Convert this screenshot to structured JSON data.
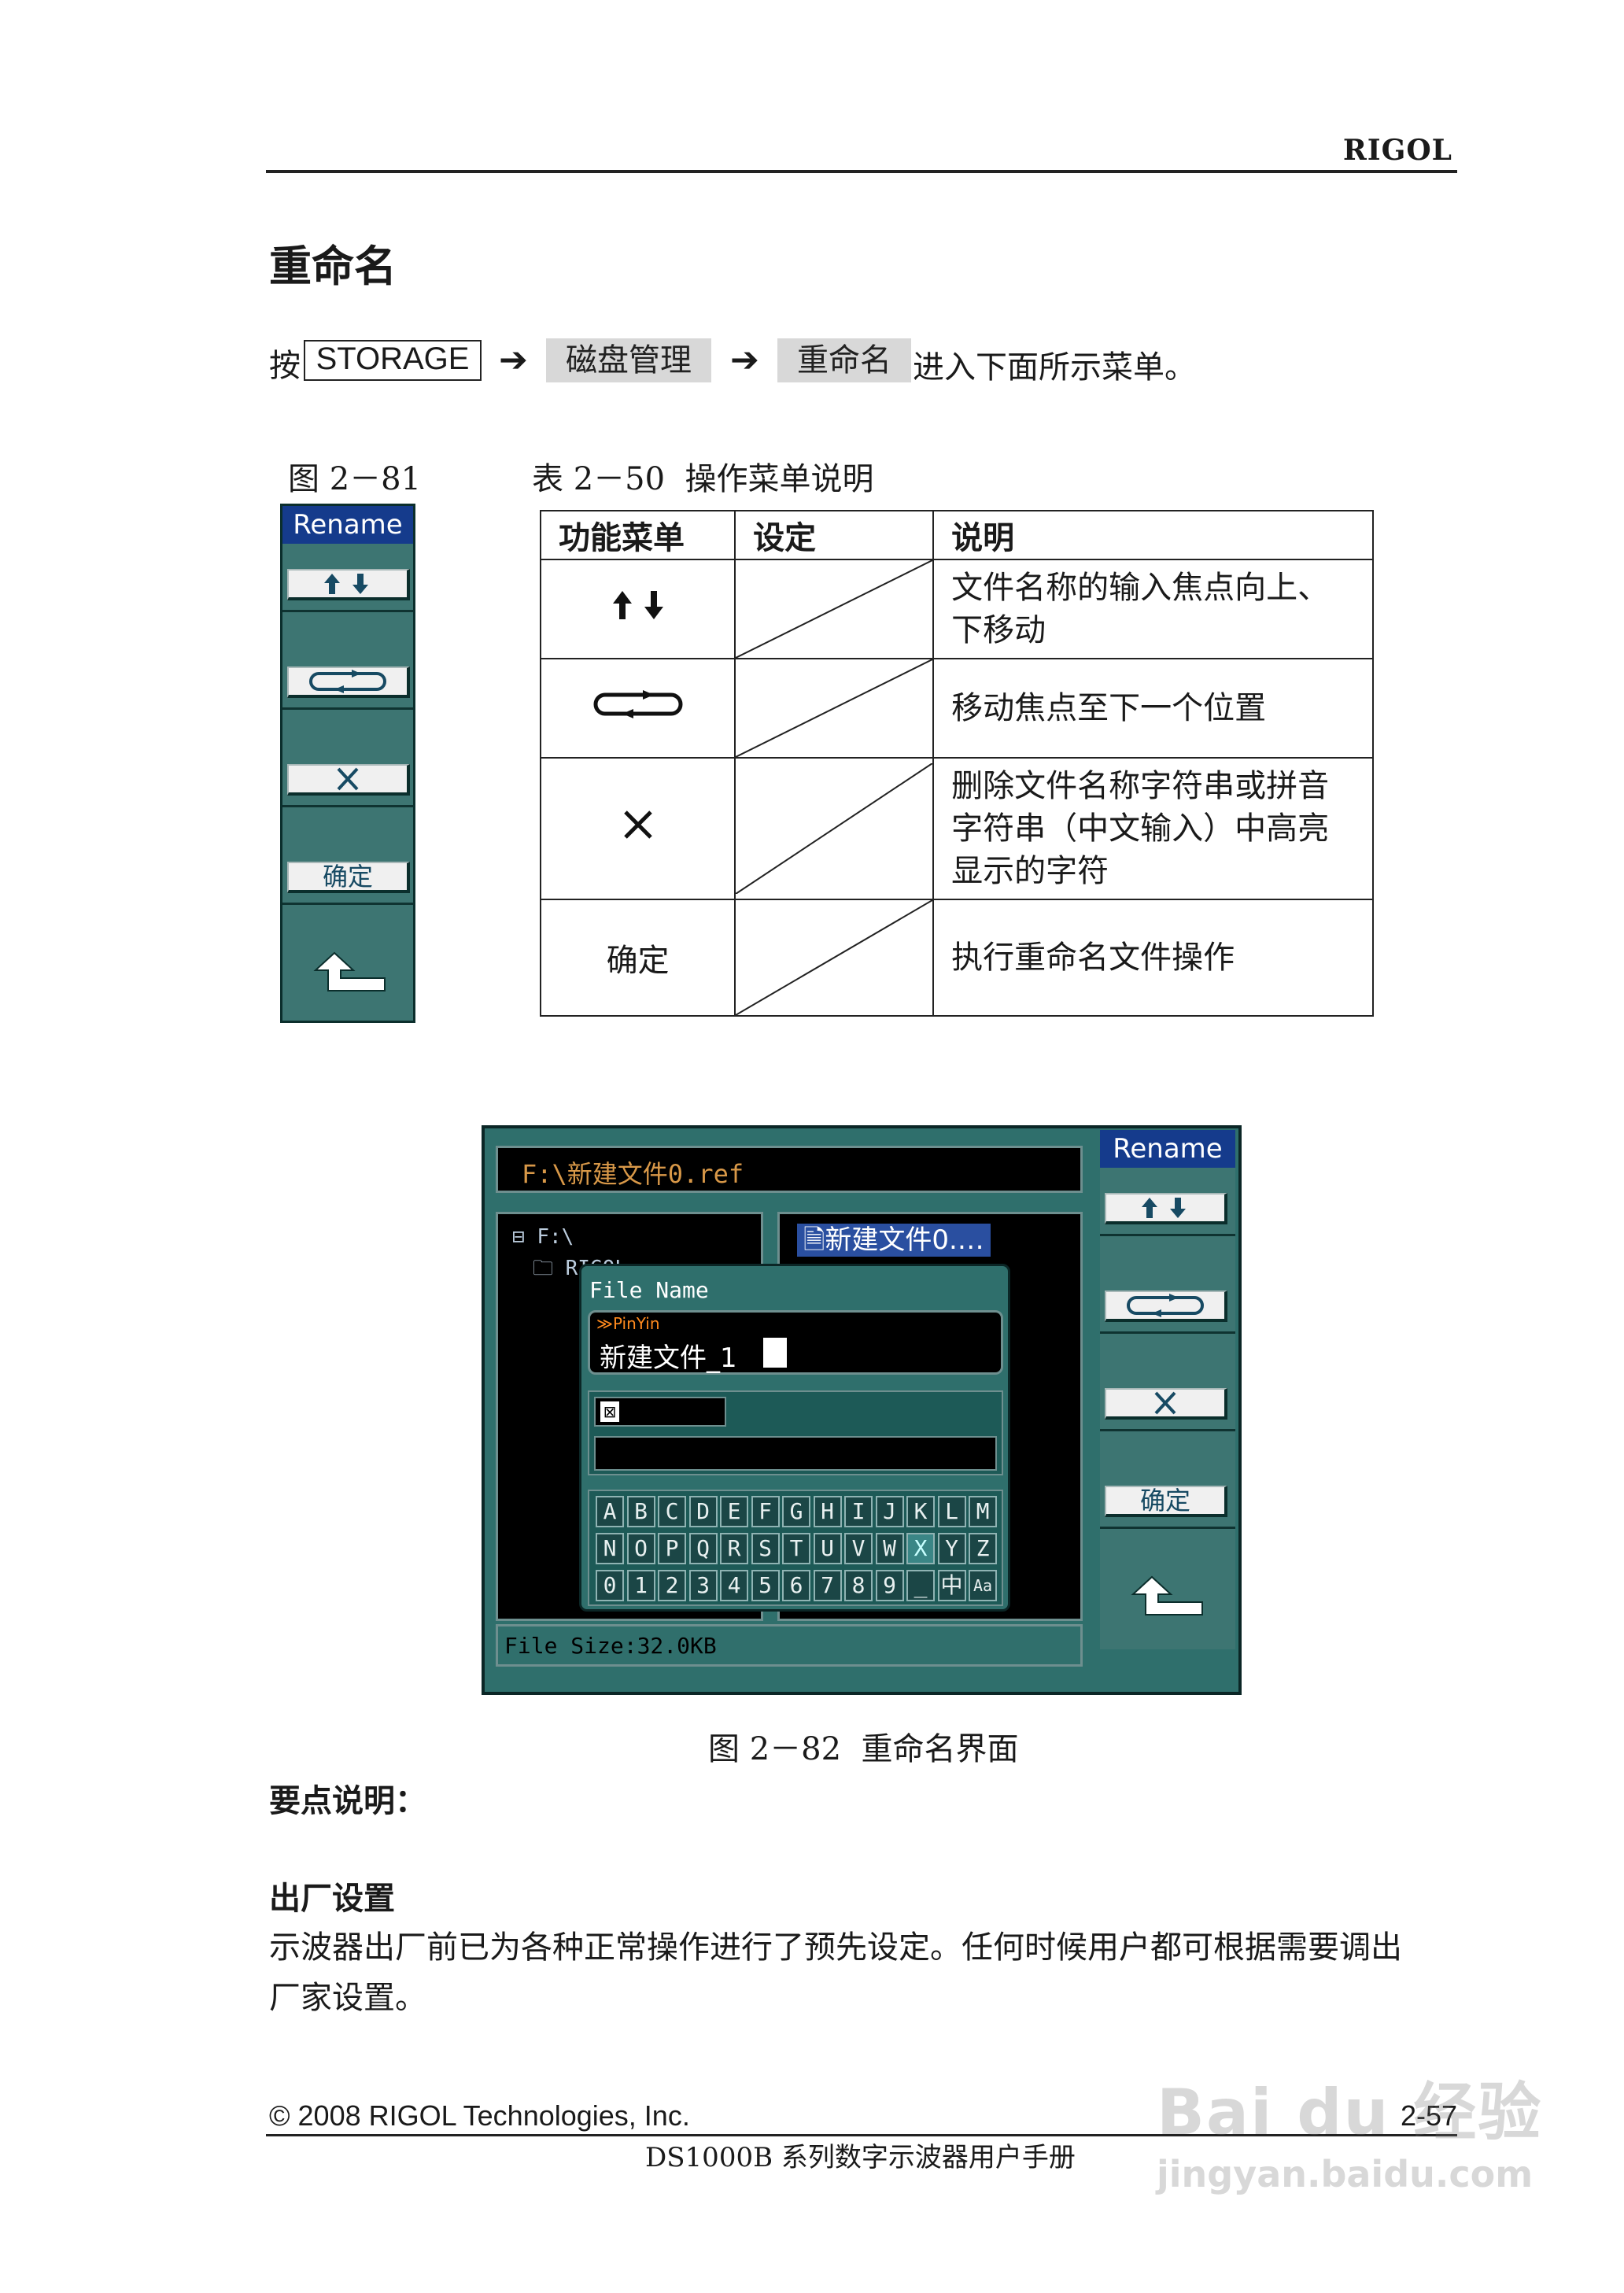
{
  "header": {
    "brand": "RIGOL"
  },
  "section": {
    "title": "重命名"
  },
  "instruction": {
    "prefix": "按",
    "key": "STORAGE",
    "step1": "磁盘管理",
    "step2": "重命名",
    "suffix": "进入下面所示菜单。"
  },
  "figure81": {
    "caption": "图 2－81"
  },
  "table50": {
    "caption": "表 2－50  操作菜单说明",
    "headers": [
      "功能菜单",
      "设定",
      "说明"
    ],
    "rows": [
      {
        "func_icon": "up-down-arrows-icon",
        "desc_lines": [
          "文件名称的输入焦点向上、",
          "下移动"
        ]
      },
      {
        "func_icon": "cycle-icon",
        "desc_lines": [
          "移动焦点至下一个位置"
        ]
      },
      {
        "func_icon": "delete-x-icon",
        "desc_lines": [
          "删除文件名称字符串或拼音",
          "字符串（中文输入）中高亮",
          "显示的字符"
        ]
      },
      {
        "func_label": "确定",
        "desc_lines": [
          "执行重命名文件操作"
        ]
      }
    ]
  },
  "menu": {
    "title": "Rename",
    "confirm_label": "确定",
    "icons": [
      "up-down-arrows-icon",
      "cycle-icon",
      "delete-x-icon",
      "return-icon"
    ]
  },
  "screen": {
    "path": "F:\\新建文件0.ref",
    "tree_root": "F:\\",
    "tree_child": "RIGOL",
    "selected_file": "新建文件0.…",
    "dialog_title": "File Name",
    "pinyin_label": "PinYin",
    "input_value": "新建文件_1",
    "file_size": "File Size:32.0KB",
    "keyboard_rows": [
      [
        "A",
        "B",
        "C",
        "D",
        "E",
        "F",
        "G",
        "H",
        "I",
        "J",
        "K",
        "L",
        "M"
      ],
      [
        "N",
        "O",
        "P",
        "Q",
        "R",
        "S",
        "T",
        "U",
        "V",
        "W",
        "X",
        "Y",
        "Z"
      ],
      [
        "0",
        "1",
        "2",
        "3",
        "4",
        "5",
        "6",
        "7",
        "8",
        "9",
        "_",
        "中",
        "Aa"
      ]
    ],
    "selected_key": "X"
  },
  "figure82": {
    "caption": "图 2－82  重命名界面"
  },
  "notes": {
    "heading": "要点说明：",
    "sub_heading": "出厂设置",
    "para_line1": "示波器出厂前已为各种正常操作进行了预先设定。任何时候用户都可根据需要调出",
    "para_line2": "厂家设置。"
  },
  "footer": {
    "copyright": "© 2008 RIGOL Technologies, Inc.",
    "page": "2-57",
    "manual": "DS1000B 系列数字示波器用户手册"
  },
  "watermark": {
    "text1": "Bai du 经验",
    "text2": "jingyan.baidu.com"
  },
  "colors": {
    "panel_teal": "#3d7572",
    "title_blue": "#153b8c",
    "screen_black": "#000000"
  }
}
